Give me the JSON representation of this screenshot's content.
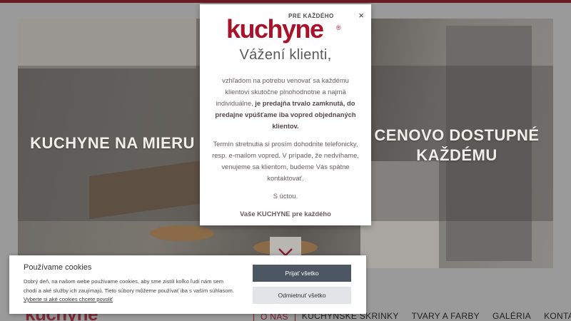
{
  "hero": {
    "left_title": "KUCHYNE NA MIERU",
    "right_title_line1": "CENOVO DOSTUPNÉ",
    "right_title_line2": "KAŽDÉMU"
  },
  "site_logo": "kuchyne",
  "nav": {
    "items": [
      "O NÁS",
      "KUCHYNSKÉ SKRINKY",
      "TVARY A FARBY",
      "GALÉRIA",
      "KONTAKT"
    ]
  },
  "modal": {
    "close_label": "×",
    "brand_pre": "PRE KAŽDÉHO",
    "brand_name": "kuchyne",
    "brand_reg": "®",
    "greeting": "Vážení klienti,",
    "para1_plain": "vzhľadom na potrebu venovať sa každému klientovi skutočne plnohodnotne a najmä individuálne, ",
    "para1_bold": "je predajňa trvalo zamknutá, do predajne vpúšťame iba vopred objednaných klientov.",
    "para2": "Termín stretnutia si prosím dohodnite telefonicky, resp. e-mailom vopred. V prípade, že nedvíhame, venujeme sa klientom, budeme Vás spätne kontaktovať.",
    "para3": "S úctou.",
    "para4": "Vaše KUCHYNE pre každého"
  },
  "cookie": {
    "title": "Používame cookies",
    "text": "Dobrý deň, na našom webe používame cookies, aby sme zistili koľko ľudí nám sem chodí a aké služby ich zaujímajú. Tieto súbory môžeme používať iba s vaším súhlasom. ",
    "link": "Vyberte si aké cookies chcete povoliť",
    "accept_label": "Prijať všetko",
    "reject_label": "Odmietnuť všetko"
  },
  "icons": {
    "scroll_down": "chevron-down-icon",
    "close": "close-icon"
  },
  "colors": {
    "brand": "#a8132b",
    "accept_button": "#4c5763",
    "reject_button": "#e2e4e7"
  }
}
